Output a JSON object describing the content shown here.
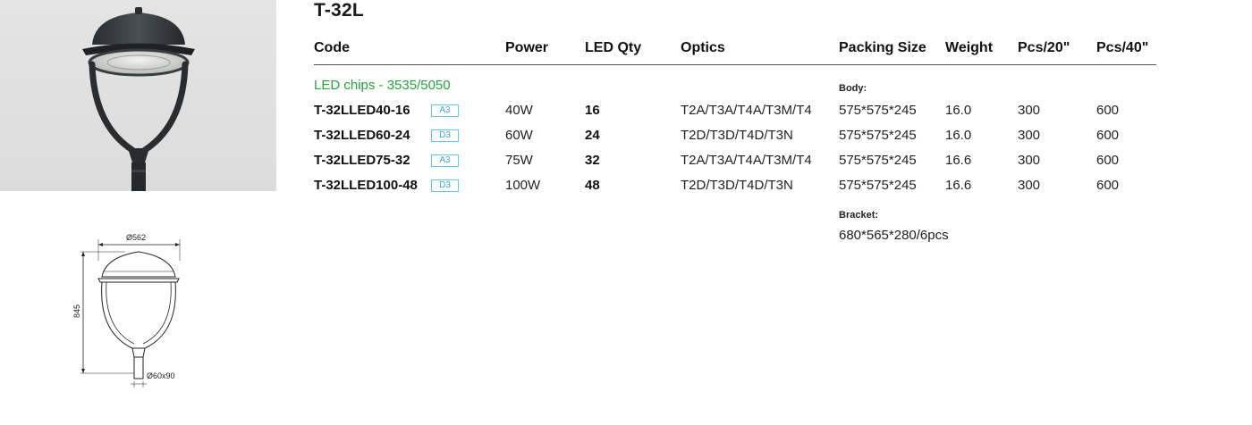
{
  "product": {
    "title": "T-32L"
  },
  "table": {
    "headers": {
      "code": "Code",
      "power": "Power",
      "led_qty": "LED Qty",
      "optics": "Optics",
      "packing_size": "Packing Size",
      "weight": "Weight",
      "pcs20": "Pcs/20\"",
      "pcs40": "Pcs/40\""
    },
    "chips_note": "LED chips - 3535/5050",
    "body_label": "Body:",
    "bracket_label": "Bracket:",
    "bracket_value": "680*565*280/6pcs",
    "rows": [
      {
        "code": "T-32LLED40-16",
        "badge": "A3",
        "power": "40W",
        "qty": "16",
        "optics": "T2A/T3A/T4A/T3M/T4",
        "packing": "575*575*245",
        "weight": "16.0",
        "pcs20": "300",
        "pcs40": "600"
      },
      {
        "code": "T-32LLED60-24",
        "badge": "D3",
        "power": "60W",
        "qty": "24",
        "optics": "T2D/T3D/T4D/T3N",
        "packing": "575*575*245",
        "weight": "16.0",
        "pcs20": "300",
        "pcs40": "600"
      },
      {
        "code": "T-32LLED75-32",
        "badge": "A3",
        "power": "75W",
        "qty": "32",
        "optics": "T2A/T3A/T4A/T3M/T4",
        "packing": "575*575*245",
        "weight": "16.6",
        "pcs20": "300",
        "pcs40": "600"
      },
      {
        "code": "T-32LLED100-48",
        "badge": "D3",
        "power": "100W",
        "qty": "48",
        "optics": "T2D/T3D/T4D/T3N",
        "packing": "575*575*245",
        "weight": "16.6",
        "pcs20": "300",
        "pcs40": "600"
      }
    ]
  },
  "drawing": {
    "width_label": "Ø562",
    "height_label": "845",
    "base_label": "Ø60x90"
  }
}
